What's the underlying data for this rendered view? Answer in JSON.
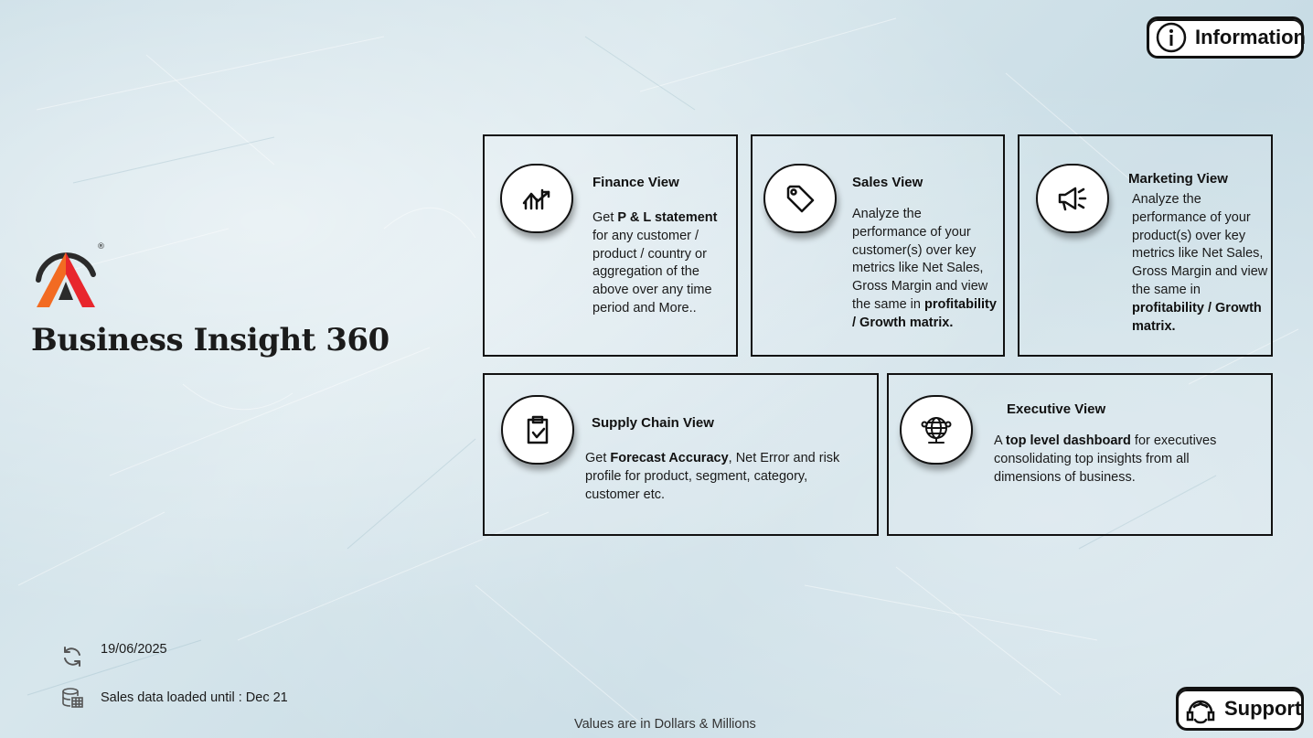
{
  "app": {
    "title": "Business Insight 360",
    "logo_registered_mark": "®",
    "brand_colors": {
      "orange": "#f15a24",
      "red": "#e8232a",
      "dark": "#2b2b2b"
    }
  },
  "header": {
    "information_button": {
      "label": "Information",
      "icon": "info-icon"
    }
  },
  "cards": [
    {
      "id": "finance",
      "title": "Finance View",
      "icon": "finance-chart-icon",
      "desc_parts": [
        "Get ",
        "P & L statement",
        " for any customer / product / country or aggregation of the above over any time period and More.."
      ]
    },
    {
      "id": "sales",
      "title": "Sales View",
      "icon": "tag-icon",
      "desc_parts": [
        "Analyze the performance of your customer(s) over key metrics like Net Sales, Gross Margin and view the same in ",
        "profitability / Growth matrix."
      ]
    },
    {
      "id": "marketing",
      "title": "Marketing View",
      "icon": "megaphone-icon",
      "desc_parts": [
        "Analyze the performance of your product(s) over key metrics like Net Sales, Gross Margin and view the same in ",
        "profitability / Growth matrix."
      ]
    },
    {
      "id": "supply_chain",
      "title": "Supply Chain View",
      "icon": "clipboard-check-icon",
      "desc_parts": [
        "Get ",
        "Forecast Accuracy",
        ", Net Error and risk profile for product, segment, category, customer etc."
      ]
    },
    {
      "id": "executive",
      "title": "Executive View",
      "icon": "globe-network-icon",
      "desc_parts": [
        "A ",
        "top level dashboard",
        " for executives consolidating top insights from all dimensions of business."
      ]
    }
  ],
  "status": {
    "refresh_date": "19/06/2025",
    "refresh_icon": "refresh-icon",
    "data_loaded": "Sales data loaded until : Dec 21",
    "data_icon": "database-table-icon"
  },
  "footer": {
    "note": "Values are in Dollars & Millions",
    "support_button": {
      "label": "Support",
      "icon": "support-agent-icon"
    }
  }
}
